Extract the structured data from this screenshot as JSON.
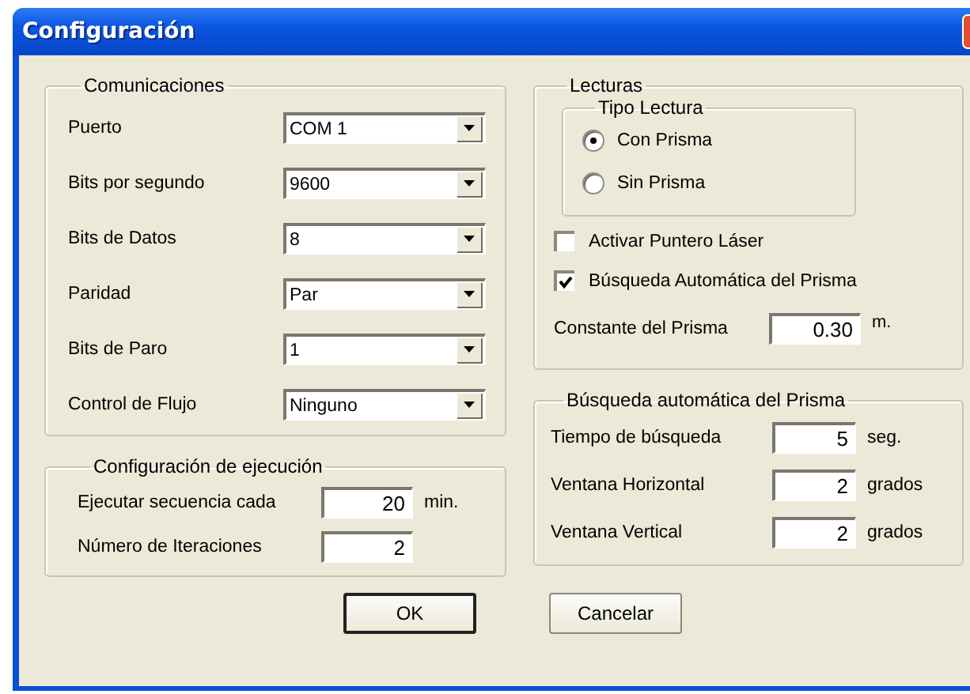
{
  "window": {
    "title": "Configuración"
  },
  "communications": {
    "title": "Comunicaciones",
    "fields": [
      {
        "label": "Puerto",
        "value": "COM 1"
      },
      {
        "label": "Bits por segundo",
        "value": "9600"
      },
      {
        "label": "Bits de Datos",
        "value": "8"
      },
      {
        "label": "Paridad",
        "value": "Par"
      },
      {
        "label": "Bits de Paro",
        "value": "1"
      },
      {
        "label": "Control de Flujo",
        "value": "Ninguno"
      }
    ]
  },
  "execution": {
    "title": "Configuración de ejecución",
    "fields": [
      {
        "label": "Ejecutar secuencia cada",
        "value": "20",
        "unit": "min."
      },
      {
        "label": "Número de Iteraciones",
        "value": "2"
      }
    ]
  },
  "readings": {
    "title": "Lecturas",
    "reading_type": {
      "title": "Tipo Lectura",
      "options": [
        {
          "label": "Con Prisma",
          "selected": true
        },
        {
          "label": "Sin Prisma",
          "selected": false
        }
      ]
    },
    "checkboxes": [
      {
        "label": "Activar Puntero Láser",
        "checked": false
      },
      {
        "label": "Búsqueda Automática del Prisma",
        "checked": true
      }
    ],
    "prism_constant": {
      "label": "Constante del Prisma",
      "value": "0.30",
      "unit": "m."
    }
  },
  "search": {
    "title": "Búsqueda automática del Prisma",
    "fields": [
      {
        "label": "Tiempo de búsqueda",
        "value": "5",
        "unit": "seg."
      },
      {
        "label": "Ventana Horizontal",
        "value": "2",
        "unit": "grados"
      },
      {
        "label": "Ventana Vertical",
        "value": "2",
        "unit": "grados"
      }
    ]
  },
  "buttons": [
    {
      "label": "OK",
      "default": true
    },
    {
      "label": "Cancelar",
      "default": false
    }
  ]
}
